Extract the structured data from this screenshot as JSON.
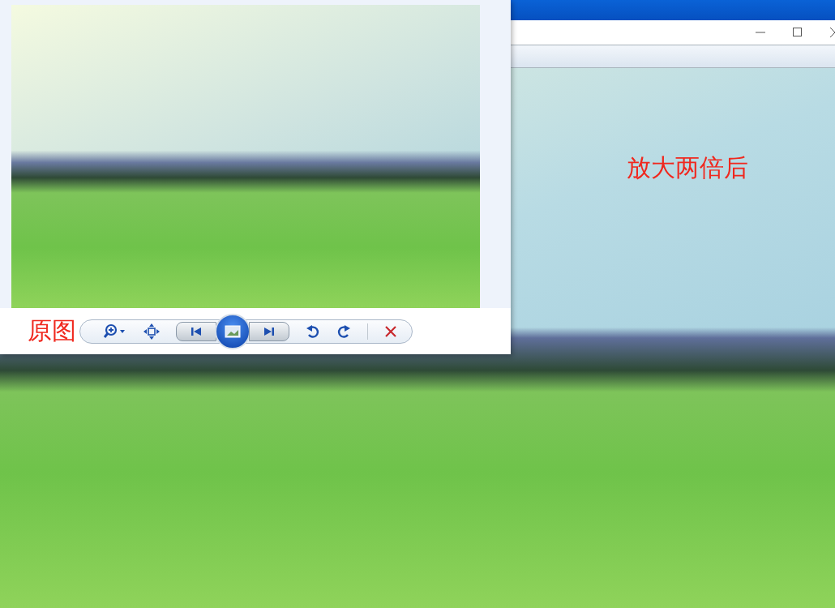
{
  "enlarged_window": {
    "annotation": "放大两倍后"
  },
  "original_window": {
    "annotation": "原图"
  }
}
